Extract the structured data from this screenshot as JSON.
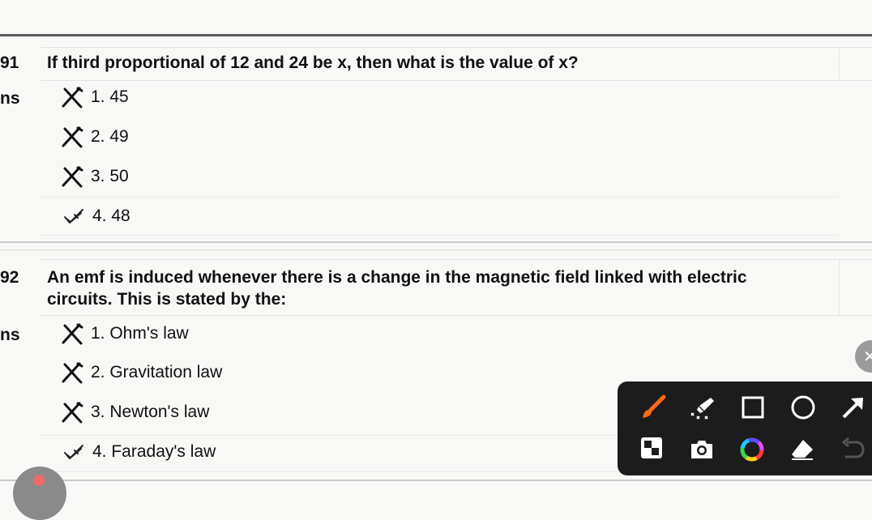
{
  "questions": [
    {
      "number": "91",
      "text": "If third proportional of 12 and 24 be x, then what is the value of x?",
      "ans_label": "ns",
      "options": [
        {
          "label": "1. 45",
          "status": "wrong"
        },
        {
          "label": "2. 49",
          "status": "wrong"
        },
        {
          "label": "3. 50",
          "status": "wrong"
        },
        {
          "label": "4. 48",
          "status": "correct"
        }
      ]
    },
    {
      "number": "92",
      "text_line1": "An emf is induced whenever there is a change in the magnetic field linked with electric",
      "text_line2": "circuits. This is stated by the:",
      "ans_label": "ns",
      "options": [
        {
          "label": "1. Ohm's law",
          "status": "wrong"
        },
        {
          "label": "2. Gravitation law",
          "status": "wrong"
        },
        {
          "label": "3. Newton's law",
          "status": "wrong"
        },
        {
          "label": "4. Faraday's law",
          "status": "correct"
        }
      ]
    }
  ],
  "icons": {
    "wrong": "cross-mark-icon",
    "correct": "check-mark-icon",
    "close": "close-icon"
  },
  "toolbar": {
    "tools": [
      "brush-icon",
      "highlighter-icon",
      "rectangle-icon",
      "circle-icon",
      "arrow-icon",
      "mosaic-icon",
      "camera-icon",
      "color-wheel-icon",
      "eraser-icon",
      "undo-icon"
    ],
    "accent": "#ff6a1a"
  },
  "close_glyph": "✕"
}
